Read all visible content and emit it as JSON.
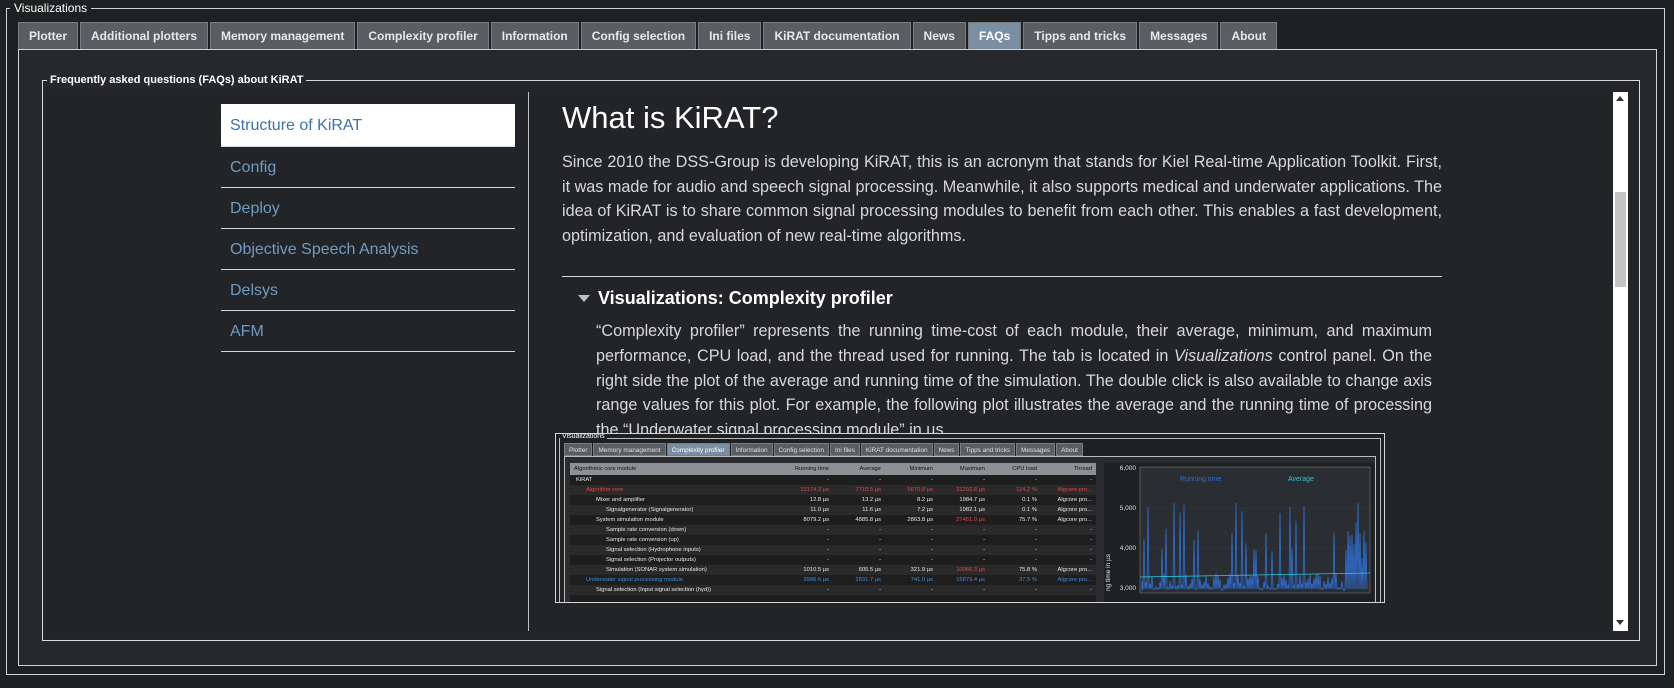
{
  "window": {
    "group_title": "Visualizations"
  },
  "tabs": [
    {
      "label": "Plotter"
    },
    {
      "label": "Additional plotters"
    },
    {
      "label": "Memory management"
    },
    {
      "label": "Complexity profiler"
    },
    {
      "label": "Information"
    },
    {
      "label": "Config selection"
    },
    {
      "label": "Ini files"
    },
    {
      "label": "KiRAT documentation"
    },
    {
      "label": "News"
    },
    {
      "label": "FAQs",
      "active": true
    },
    {
      "label": "Tipps and tricks"
    },
    {
      "label": "Messages"
    },
    {
      "label": "About"
    }
  ],
  "faq": {
    "group_title": "Frequently asked questions (FAQs) about KiRAT",
    "sidebar": [
      {
        "label": "Structure of KiRAT"
      },
      {
        "label": "Config"
      },
      {
        "label": "Deploy"
      },
      {
        "label": "Objective Speech Analysis"
      },
      {
        "label": "Delsys"
      },
      {
        "label": "AFM"
      }
    ],
    "article": {
      "title": "What is KiRAT?",
      "intro": "Since 2010 the DSS-Group is developing KiRAT, this is an acronym that stands for Kiel Real-time Application Toolkit. First, it was made for audio and speech signal processing. Meanwhile, it also supports medical and underwater applications. The idea of KiRAT is to share common signal processing modules to benefit from each other. This enables a fast development, optimization, and evaluation of new real-time algorithms.",
      "section_title": "Visualizations: Complexity profiler",
      "section_text_1": "“Complexity profiler” represents the running time-cost of each module, their average, minimum, and maximum performance, CPU load, and the thread used for running. The tab is located in ",
      "section_text_em": "Visualizations",
      "section_text_2": " control panel. On the right side the plot of the average and running time of the simulation. The double click is also available to change axis range values for this plot. For example, the following plot illustrates the average and the running time of processing the “Underwater signal processing module” in µs."
    }
  },
  "embedded": {
    "title": "Visualizations",
    "tabs": [
      "Plotter",
      "Memory management",
      "Complexity profiler",
      "Information",
      "Config selection",
      "Ini files",
      "KiRAT documentation",
      "News",
      "Tipps and tricks",
      "Messages",
      "About"
    ],
    "active_tab": "Complexity profiler",
    "columns": [
      "Algorithmic core module",
      "Running time",
      "Average",
      "Minimum",
      "Maximum",
      "CPU load",
      "Thread"
    ],
    "rows": [
      {
        "name": "KiRAT",
        "indent": 0,
        "vals": [
          "-",
          "-",
          "-",
          "-",
          "-",
          "-"
        ],
        "color": ""
      },
      {
        "name": "Algorithm core",
        "indent": 1,
        "vals": [
          "12174.3 µs",
          "7710.5 µs",
          "5670.8 µs",
          "31292.8 µs",
          "114.2 %",
          "Algcore pro..."
        ],
        "color": "red"
      },
      {
        "name": "Mixer and amplifier",
        "indent": 2,
        "vals": [
          "12.8 µs",
          "13.2 µs",
          "8.2 µs",
          "1984.7 µs",
          "0.1 %",
          "Algcore pro..."
        ],
        "color": ""
      },
      {
        "name": "Signalgenerator (Signalgenerator)",
        "indent": 3,
        "vals": [
          "11.0 µs",
          "11.6 µs",
          "7.2 µs",
          "1982.1 µs",
          "0.1 %",
          "Algcore pro..."
        ],
        "color": ""
      },
      {
        "name": "System simulation module",
        "indent": 2,
        "vals": [
          "8079.2 µs",
          "4885.8 µs",
          "2863.8 µs",
          "27451.0 µs",
          "75.7 %",
          "Algcore pro..."
        ],
        "color": "",
        "maxred": true
      },
      {
        "name": "Sample rate conversion (down)",
        "indent": 3,
        "vals": [
          "-",
          "-",
          "-",
          "-",
          "-",
          "-"
        ],
        "color": ""
      },
      {
        "name": "Sample rate conversion (up)",
        "indent": 3,
        "vals": [
          "-",
          "-",
          "-",
          "-",
          "-",
          "-"
        ],
        "color": ""
      },
      {
        "name": "Signal selection (Hydrophone inputs)",
        "indent": 3,
        "vals": [
          "-",
          "-",
          "-",
          "-",
          "-",
          "-"
        ],
        "color": ""
      },
      {
        "name": "Signal selection (Projector outputs)",
        "indent": 3,
        "vals": [
          "-",
          "-",
          "-",
          "-",
          "-",
          "-"
        ],
        "color": ""
      },
      {
        "name": "Simulation (SONAR system simulation)",
        "indent": 3,
        "vals": [
          "1010.5 µs",
          "605.5 µs",
          "321.9 µs",
          "10066.3 µs",
          "75.8 %",
          "Algcore pro..."
        ],
        "color": "",
        "maxred": true
      },
      {
        "name": "Underwater signal processing module",
        "indent": 1,
        "vals": [
          "3996.6 µs",
          "2831.7 µs",
          "741.0 µs",
          "15879.4 µs",
          "37.5 %",
          "Algcore pro..."
        ],
        "color": "blue"
      },
      {
        "name": "Signal selection (Input signal selection (hyd))",
        "indent": 2,
        "vals": [
          "-",
          "-",
          "-",
          "-",
          "-",
          "-"
        ],
        "color": ""
      }
    ],
    "plot": {
      "legend_running": "Running time",
      "legend_average": "Average",
      "ylabel": "ng time in µs",
      "yticks": [
        "6,000",
        "5,000",
        "4,000",
        "3,000"
      ],
      "running_color": "#2f6fd6",
      "average_color": "#2ec7d6"
    }
  }
}
